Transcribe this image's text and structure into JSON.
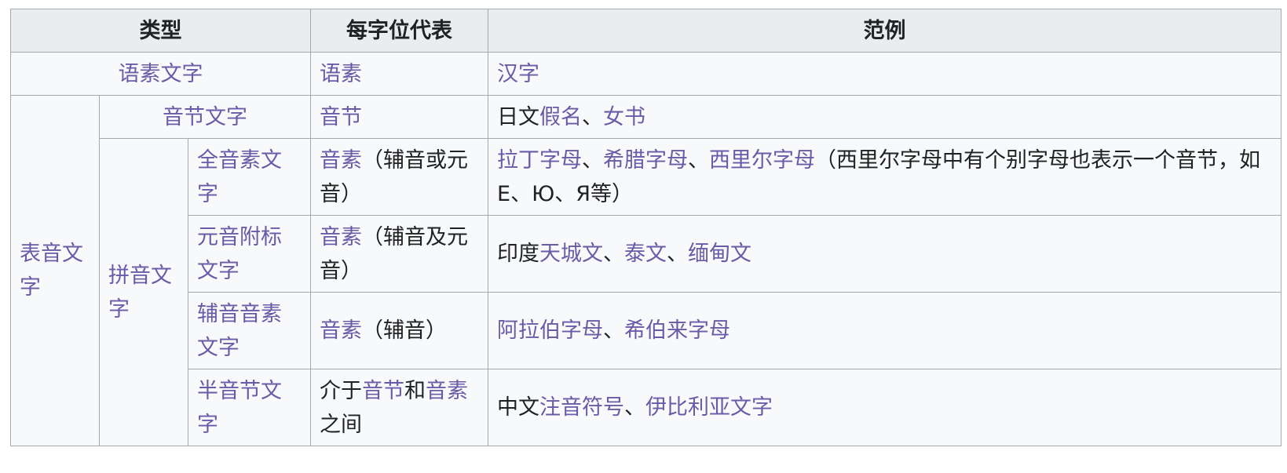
{
  "table": {
    "headers": {
      "type": "类型",
      "unit": "每字位代表",
      "examples": "范例"
    },
    "sep": "、",
    "rows": {
      "logographic": {
        "type": "语素文字",
        "unit": "语素",
        "examples": {
          "e1": "汉字"
        }
      },
      "phonetic": {
        "type": "表音文字"
      },
      "syllabic": {
        "type": "音节文字",
        "unit": "音节",
        "examples": {
          "prefix": "日文",
          "e1": "假名",
          "e2": "女书"
        }
      },
      "segmental": {
        "type": "拼音文字"
      },
      "alphabet": {
        "type": "全音素文字",
        "unit_link": "音素",
        "unit_text": "（辅音或元音）",
        "examples": {
          "e1": "拉丁字母",
          "e2": "希腊字母",
          "e3": "西里尔字母",
          "note": "（西里尔字母中有个别字母也表示一个音节，如Е、Ю、Я等）"
        }
      },
      "abugida": {
        "type": "元音附标文字",
        "unit_link": "音素",
        "unit_text": "（辅音及元音）",
        "examples": {
          "prefix": "印度",
          "e1": "天城文",
          "e2": "泰文",
          "e3": "缅甸文"
        }
      },
      "abjad": {
        "type": "辅音音素文字",
        "unit_link": "音素",
        "unit_text": "（辅音）",
        "examples": {
          "e1": "阿拉伯字母",
          "e2": "希伯来字母"
        }
      },
      "semisyllabary": {
        "type": "半音节文字",
        "unit_prefix": "介于",
        "unit_link1": "音节",
        "unit_mid": "和",
        "unit_link2": "音素",
        "unit_suffix": "之间",
        "examples": {
          "prefix": "中文",
          "e1": "注音符号",
          "e2": "伊比利亚文字"
        }
      }
    }
  },
  "colors": {
    "link": "#6b5aa8",
    "text": "#202122",
    "header_bg": "#eaecf0",
    "cell_bg": "#f8f9fa",
    "border": "#a2a9b1"
  }
}
